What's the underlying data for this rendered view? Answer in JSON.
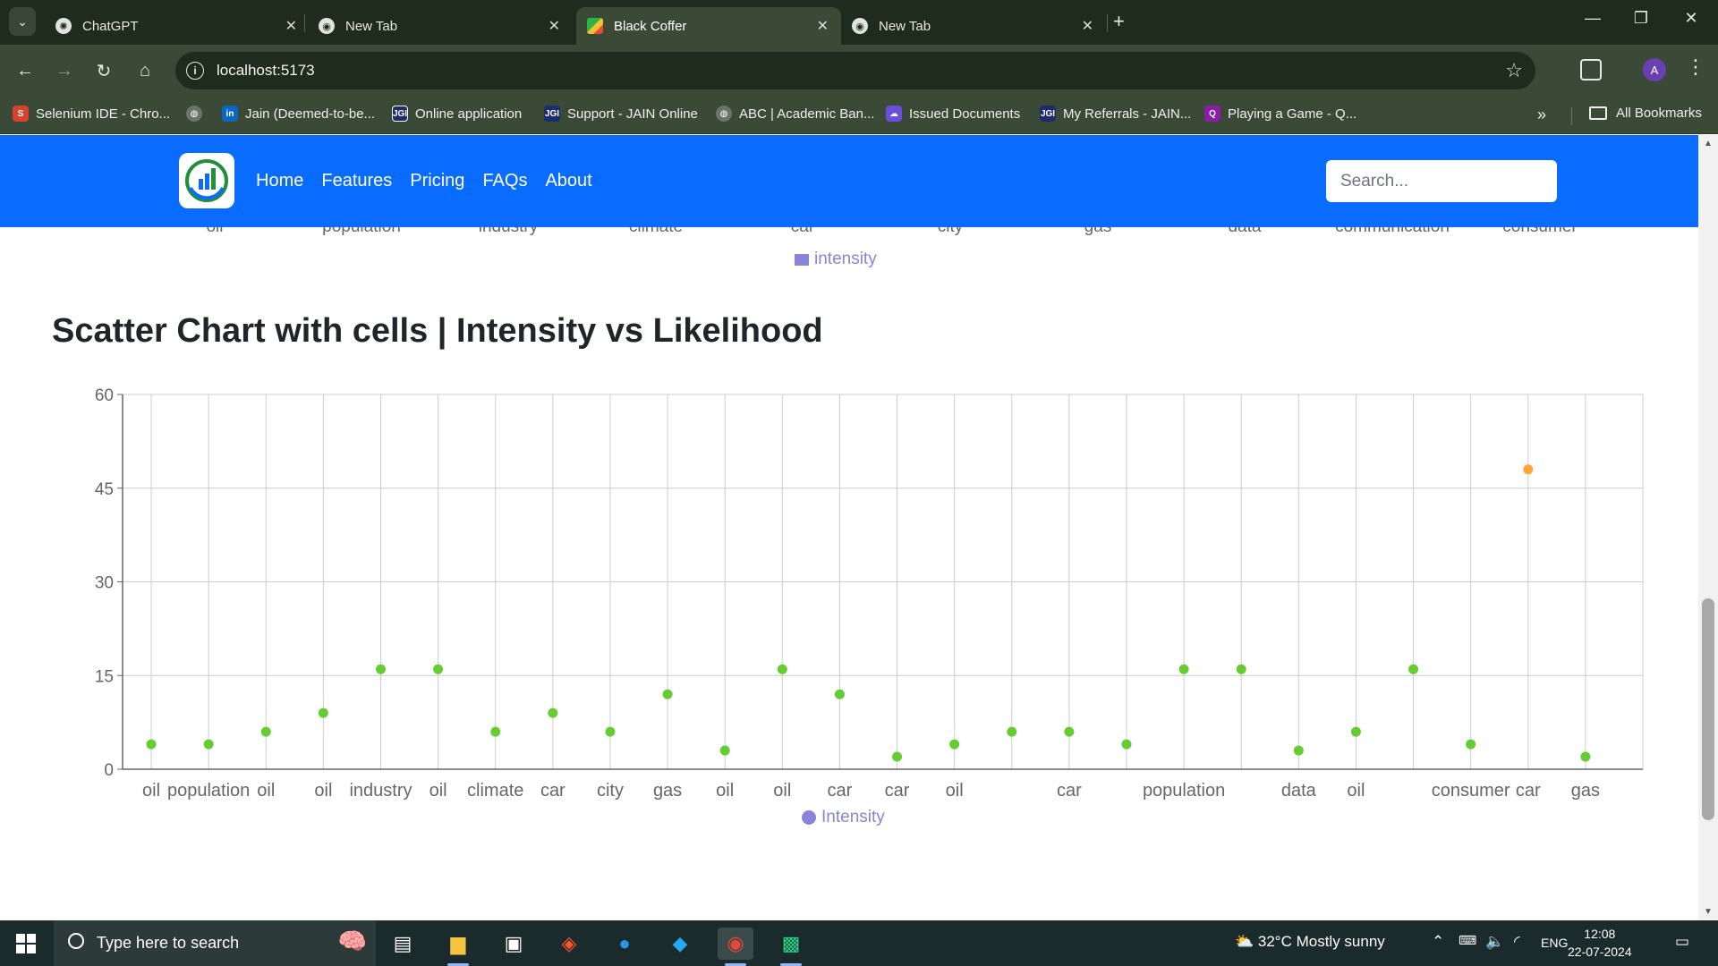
{
  "browser": {
    "tabs": [
      {
        "title": "ChatGPT",
        "active": false
      },
      {
        "title": "New Tab",
        "active": false
      },
      {
        "title": "Black Coffer",
        "active": true
      },
      {
        "title": "New Tab",
        "active": false
      }
    ],
    "url": "localhost:5173",
    "profile_initial": "A",
    "bookmarks": [
      "Selenium IDE - Chro...",
      "",
      "Jain (Deemed-to-be...",
      "Online application",
      "Support - JAIN Online",
      "ABC | Academic Ban...",
      "Issued Documents",
      "My Referrals - JAIN...",
      "Playing a Game - Q..."
    ],
    "all_bookmarks": "All Bookmarks"
  },
  "app": {
    "nav": [
      "Home",
      "Features",
      "Pricing",
      "FAQs",
      "About"
    ],
    "search_placeholder": "Search...",
    "prev_chart": {
      "ticks": [
        "oil",
        "population",
        "industry",
        "climate",
        "car",
        "city",
        "gas",
        "data",
        "communication",
        "consumer"
      ],
      "legend": "intensity",
      "legend_color": "#8884d8"
    },
    "section_title": "Scatter Chart with cells | Intensity vs Likelihood"
  },
  "chart_data": {
    "type": "scatter",
    "title": "Scatter Chart with cells | Intensity vs Likelihood",
    "x_categories": [
      "oil",
      "population",
      "oil",
      "oil",
      "industry",
      "oil",
      "climate",
      "car",
      "city",
      "gas",
      "oil",
      "oil",
      "car",
      "car",
      "oil",
      "",
      "car",
      "",
      "population",
      "",
      "data",
      "oil",
      "",
      "consumer",
      "car",
      "gas"
    ],
    "series": [
      {
        "name": "Intensity",
        "values": [
          4,
          4,
          6,
          9,
          16,
          16,
          6,
          9,
          6,
          12,
          3,
          16,
          12,
          2,
          4,
          6,
          6,
          4,
          16,
          16,
          3,
          6,
          16,
          4,
          48,
          2
        ]
      }
    ],
    "highlight_index": 24,
    "point_color": "#66cc33",
    "highlight_color": "#ffa53a",
    "ylim": [
      0,
      60
    ],
    "yticks": [
      0,
      15,
      30,
      45,
      60
    ],
    "grid": true,
    "legend": "bottom-center",
    "legend_color": "#8884d8"
  },
  "taskbar": {
    "search_placeholder": "Type here to search",
    "weather": "32°C  Mostly sunny",
    "language": "ENG",
    "time": "12:08",
    "date": "22-07-2024"
  }
}
